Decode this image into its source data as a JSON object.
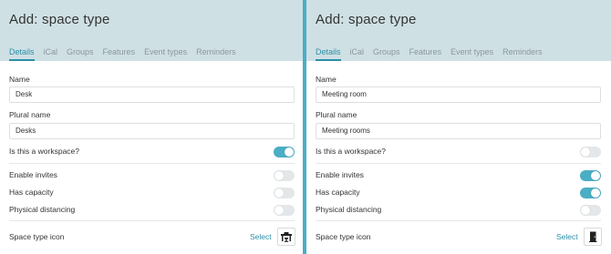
{
  "left": {
    "title": "Add: space type",
    "tabs": [
      "Details",
      "iCal",
      "Groups",
      "Features",
      "Event types",
      "Reminders"
    ],
    "name_label": "Name",
    "name_value": "Desk",
    "plural_label": "Plural name",
    "plural_value": "Desks",
    "workspace_label": "Is this a workspace?",
    "workspace_on": true,
    "invites_label": "Enable invites",
    "invites_on": false,
    "capacity_label": "Has capacity",
    "capacity_on": false,
    "distancing_label": "Physical distancing",
    "distancing_on": false,
    "icon_label": "Space type icon",
    "select_label": "Select",
    "icon_name": "desk-chair-icon"
  },
  "right": {
    "title": "Add: space type",
    "tabs": [
      "Details",
      "iCal",
      "Groups",
      "Features",
      "Event types",
      "Reminders"
    ],
    "name_label": "Name",
    "name_value": "Meeting room",
    "plural_label": "Plural name",
    "plural_value": "Meeting rooms",
    "workspace_label": "Is this a workspace?",
    "workspace_on": false,
    "invites_label": "Enable invites",
    "invites_on": true,
    "capacity_label": "Has capacity",
    "capacity_on": true,
    "distancing_label": "Physical distancing",
    "distancing_on": false,
    "icon_label": "Space type icon",
    "select_label": "Select",
    "icon_name": "door-icon"
  },
  "colors": {
    "accent": "#4aaec4",
    "header_bg": "#cfe0e4",
    "active_tab": "#2b8fa7"
  }
}
